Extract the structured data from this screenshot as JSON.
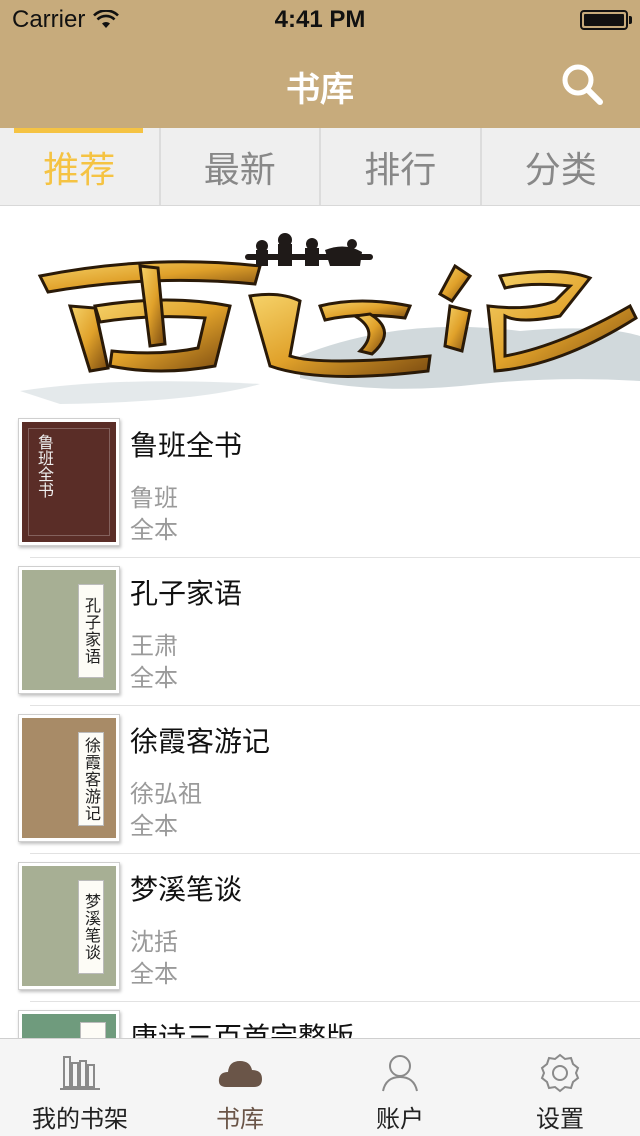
{
  "status_bar": {
    "carrier": "Carrier",
    "time": "4:41 PM"
  },
  "nav": {
    "title": "书库",
    "search_icon": "search-icon"
  },
  "tabs": [
    {
      "label": "推荐",
      "active": true
    },
    {
      "label": "最新",
      "active": false
    },
    {
      "label": "排行",
      "active": false
    },
    {
      "label": "分类",
      "active": false
    }
  ],
  "banner": {
    "name": "journey-to-the-west-banner",
    "calligraphy": "西游记"
  },
  "books": [
    {
      "title": "鲁班全书",
      "author": "鲁班",
      "status": "全本",
      "cover_text": "鲁班全书"
    },
    {
      "title": "孔子家语",
      "author": "王肃",
      "status": "全本",
      "cover_text": "孔子家语"
    },
    {
      "title": "徐霞客游记",
      "author": "徐弘祖",
      "status": "全本",
      "cover_text": "徐霞客游记"
    },
    {
      "title": "梦溪笔谈",
      "author": "沈括",
      "status": "全本",
      "cover_text": "梦溪笔谈"
    },
    {
      "title": "唐诗三百首完整版",
      "author": "",
      "status": "",
      "cover_text": ""
    }
  ],
  "tabbar": [
    {
      "label": "我的书架",
      "icon": "bookshelf-icon",
      "active": false
    },
    {
      "label": "书库",
      "icon": "cloud-icon",
      "active": true
    },
    {
      "label": "账户",
      "icon": "user-icon",
      "active": false
    },
    {
      "label": "设置",
      "icon": "gear-icon",
      "active": false
    }
  ],
  "colors": {
    "bar": "#c7ab7c",
    "accent": "#f5c343",
    "active_tab_icon": "#6a5548"
  }
}
